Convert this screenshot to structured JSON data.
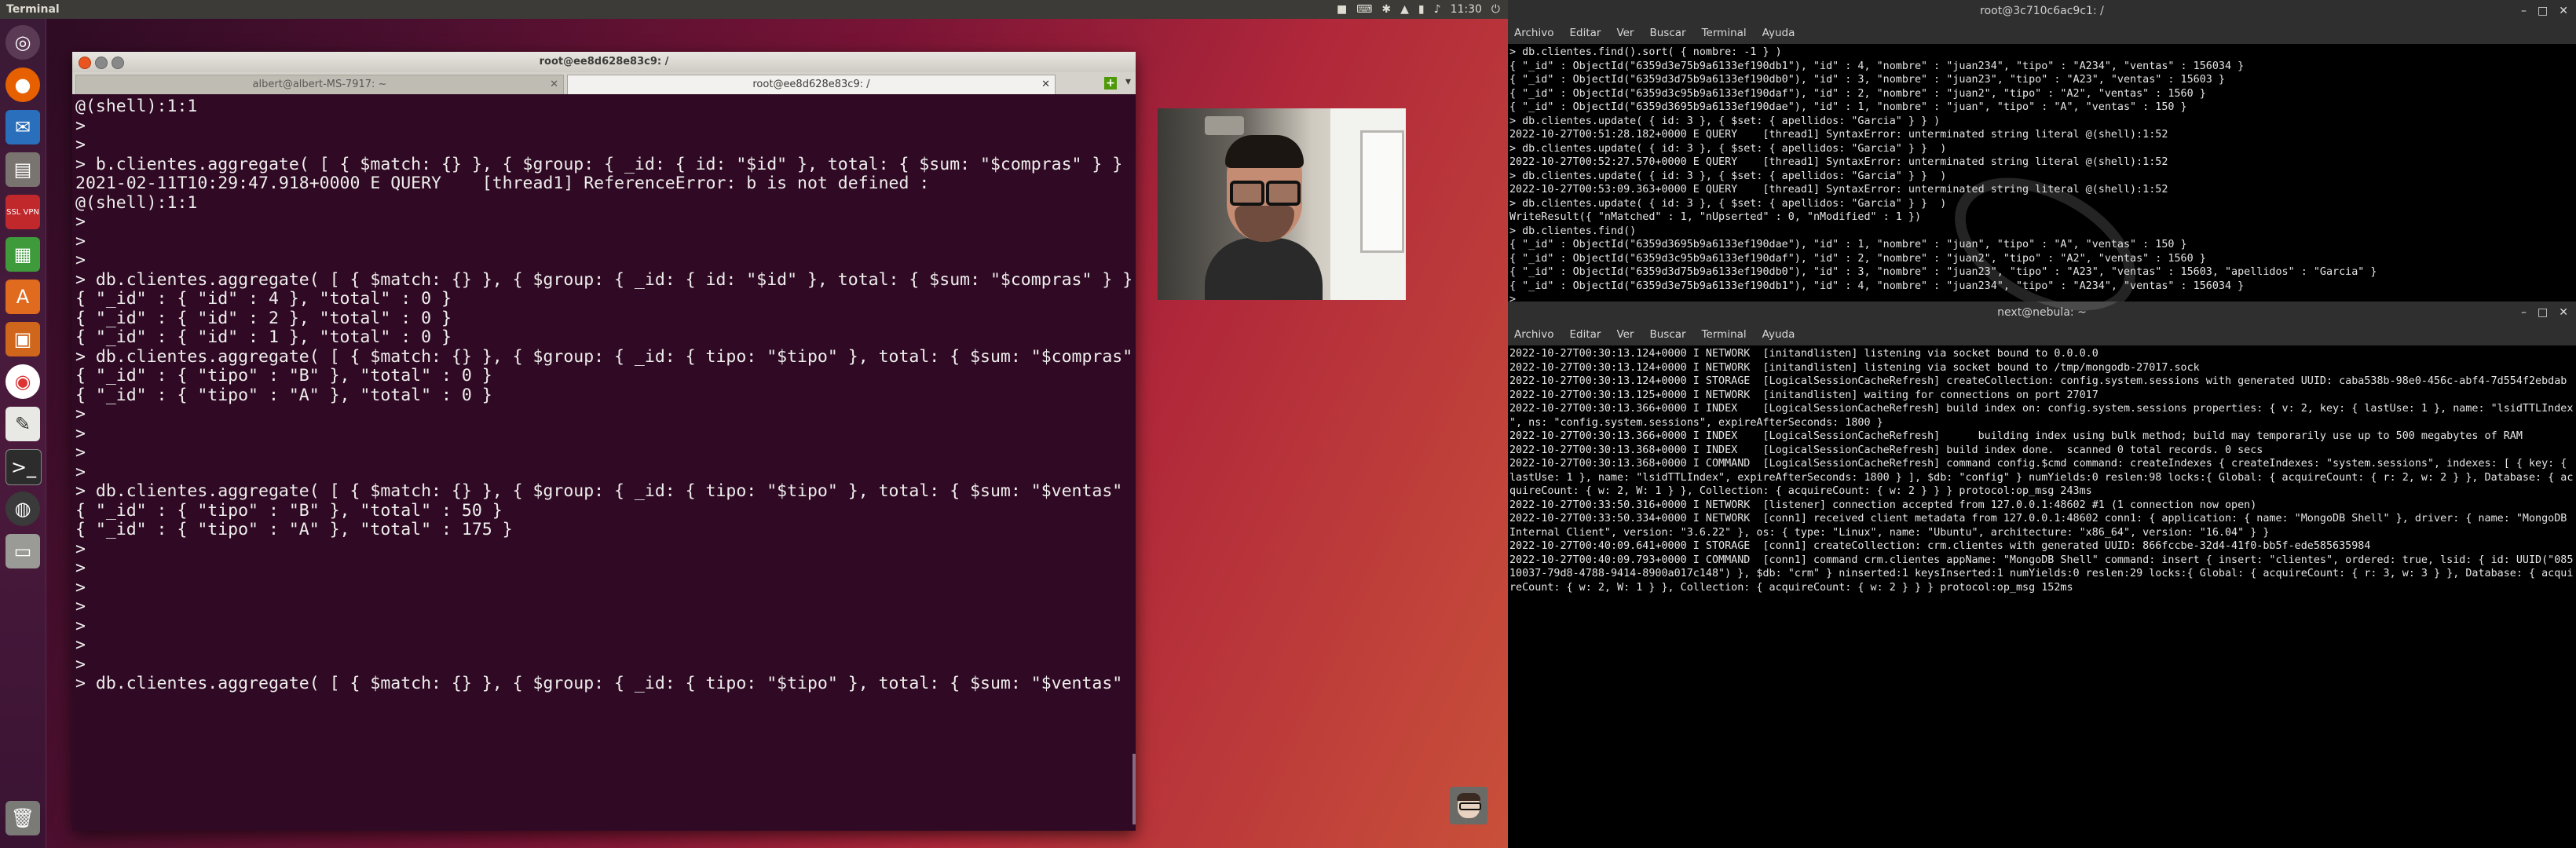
{
  "topbar": {
    "app_title": "Terminal",
    "clock": "11:30",
    "tray_icons": [
      "video-icon",
      "keyboard-icon",
      "bluetooth-icon",
      "wifi-icon",
      "battery-icon",
      "volume-icon",
      "power-icon"
    ]
  },
  "launcher": {
    "items": [
      "ubuntu-icon",
      "firefox-icon",
      "thunderbird-icon",
      "files-icon",
      "ssl-vpn-icon",
      "calc-icon",
      "software-icon",
      "presentation-icon",
      "chrome-icon",
      "editor-icon",
      "terminal-icon",
      "obs-icon",
      "storage-icon",
      "trash-icon"
    ],
    "ssl_label": "SSL VPN"
  },
  "left_terminal": {
    "title": "root@ee8d628e83c9: /",
    "tabs": [
      {
        "label": "albert@albert-MS-7917: ~"
      },
      {
        "label": "root@ee8d628e83c9: /"
      }
    ],
    "output": "@(shell):1:1\n>\n> \n> b.clientes.aggregate( [ { $match: {} }, { $group: { _id: { id: \"$id\" }, total: { $sum: \"$compras\" } } ] )\n2021-02-11T10:29:47.918+0000 E QUERY    [thread1] ReferenceError: b is not defined :\n@(shell):1:1\n>\n>\n>\n> db.clientes.aggregate( [ { $match: {} }, { $group: { _id: { id: \"$id\" }, total: { $sum: \"$compras\" } } } ] )\n{ \"_id\" : { \"id\" : 4 }, \"total\" : 0 }\n{ \"_id\" : { \"id\" : 2 }, \"total\" : 0 }\n{ \"_id\" : { \"id\" : 1 }, \"total\" : 0 }\n> db.clientes.aggregate( [ { $match: {} }, { $group: { _id: { tipo: \"$tipo\" }, total: { $sum: \"$compras\" } } } ] )\n{ \"_id\" : { \"tipo\" : \"B\" }, \"total\" : 0 }\n{ \"_id\" : { \"tipo\" : \"A\" }, \"total\" : 0 }\n>\n>\n>\n>\n> db.clientes.aggregate( [ { $match: {} }, { $group: { _id: { tipo: \"$tipo\" }, total: { $sum: \"$ventas\" } } } ] )\n{ \"_id\" : { \"tipo\" : \"B\" }, \"total\" : 50 }\n{ \"_id\" : { \"tipo\" : \"A\" }, \"total\" : 175 }\n>\n>\n>\n>\n>\n>\n>\n> db.clientes.aggregate( [ { $match: {} }, { $group: { _id: { tipo: \"$tipo\" }, total: { $sum: \"$ventas\" } } } ] )"
  },
  "right_top": {
    "title": "root@3c710c6ac9c1: /",
    "output": "> db.clientes.find().sort( { nombre: -1 } )\n{ \"_id\" : ObjectId(\"6359d3e75b9a6133ef190db1\"), \"id\" : 4, \"nombre\" : \"juan234\", \"tipo\" : \"A234\", \"ventas\" : 156034 }\n{ \"_id\" : ObjectId(\"6359d3d75b9a6133ef190db0\"), \"id\" : 3, \"nombre\" : \"juan23\", \"tipo\" : \"A23\", \"ventas\" : 15603 }\n{ \"_id\" : ObjectId(\"6359d3c95b9a6133ef190daf\"), \"id\" : 2, \"nombre\" : \"juan2\", \"tipo\" : \"A2\", \"ventas\" : 1560 }\n{ \"_id\" : ObjectId(\"6359d3695b9a6133ef190dae\"), \"id\" : 1, \"nombre\" : \"juan\", \"tipo\" : \"A\", \"ventas\" : 150 }\n> db.clientes.update( { id: 3 }, { $set: { apellidos: \"Garcia\" } } )\n2022-10-27T00:51:28.182+0000 E QUERY    [thread1] SyntaxError: unterminated string literal @(shell):1:52\n> db.clientes.update( { id: 3 }, { $set: { apellidos: \"Garcia\" } }  )\n2022-10-27T00:52:27.570+0000 E QUERY    [thread1] SyntaxError: unterminated string literal @(shell):1:52\n> db.clientes.update( { id: 3 }, { $set: { apellidos: \"Garcia\" } }  )\n2022-10-27T00:53:09.363+0000 E QUERY    [thread1] SyntaxError: unterminated string literal @(shell):1:52\n> db.clientes.update( { id: 3 }, { $set: { apellidos: \"Garcia\" } }  )\nWriteResult({ \"nMatched\" : 1, \"nUpserted\" : 0, \"nModified\" : 1 })\n> db.clientes.find()\n{ \"_id\" : ObjectId(\"6359d3695b9a6133ef190dae\"), \"id\" : 1, \"nombre\" : \"juan\", \"tipo\" : \"A\", \"ventas\" : 150 }\n{ \"_id\" : ObjectId(\"6359d3c95b9a6133ef190daf\"), \"id\" : 2, \"nombre\" : \"juan2\", \"tipo\" : \"A2\", \"ventas\" : 1560 }\n{ \"_id\" : ObjectId(\"6359d3d75b9a6133ef190db0\"), \"id\" : 3, \"nombre\" : \"juan23\", \"tipo\" : \"A23\", \"ventas\" : 15603, \"apellidos\" : \"Garcia\" }\n{ \"_id\" : ObjectId(\"6359d3e75b9a6133ef190db1\"), \"id\" : 4, \"nombre\" : \"juan234\", \"tipo\" : \"A234\", \"ventas\" : 156034 }\n>"
  },
  "right_bottom": {
    "title": "next@nebula: ~",
    "menu": [
      "Archivo",
      "Editar",
      "Ver",
      "Buscar",
      "Terminal",
      "Ayuda"
    ],
    "output": "2022-10-27T00:30:13.124+0000 I NETWORK  [initandlisten] listening via socket bound to 0.0.0.0\n2022-10-27T00:30:13.124+0000 I NETWORK  [initandlisten] listening via socket bound to /tmp/mongodb-27017.sock\n2022-10-27T00:30:13.124+0000 I STORAGE  [LogicalSessionCacheRefresh] createCollection: config.system.sessions with generated UUID: caba538b-98e0-456c-abf4-7d554f2ebdab\n2022-10-27T00:30:13.125+0000 I NETWORK  [initandlisten] waiting for connections on port 27017\n2022-10-27T00:30:13.366+0000 I INDEX    [LogicalSessionCacheRefresh] build index on: config.system.sessions properties: { v: 2, key: { lastUse: 1 }, name: \"lsidTTLIndex\n\", ns: \"config.system.sessions\", expireAfterSeconds: 1800 }\n2022-10-27T00:30:13.366+0000 I INDEX    [LogicalSessionCacheRefresh]      building index using bulk method; build may temporarily use up to 500 megabytes of RAM\n2022-10-27T00:30:13.368+0000 I INDEX    [LogicalSessionCacheRefresh] build index done.  scanned 0 total records. 0 secs\n2022-10-27T00:30:13.368+0000 I COMMAND  [LogicalSessionCacheRefresh] command config.$cmd command: createIndexes { createIndexes: \"system.sessions\", indexes: [ { key: {\nlastUse: 1 }, name: \"lsidTTLIndex\", expireAfterSeconds: 1800 } ], $db: \"config\" } numYields:0 reslen:98 locks:{ Global: { acquireCount: { r: 2, w: 2 } }, Database: { ac\nquireCount: { w: 2, W: 1 } }, Collection: { acquireCount: { w: 2 } } } protocol:op_msg 243ms\n2022-10-27T00:33:50.316+0000 I NETWORK  [listener] connection accepted from 127.0.0.1:48602 #1 (1 connection now open)\n2022-10-27T00:33:50.334+0000 I NETWORK  [conn1] received client metadata from 127.0.0.1:48602 conn1: { application: { name: \"MongoDB Shell\" }, driver: { name: \"MongoDB\nInternal Client\", version: \"3.6.22\" }, os: { type: \"Linux\", name: \"Ubuntu\", architecture: \"x86_64\", version: \"16.04\" } }\n2022-10-27T00:40:09.641+0000 I STORAGE  [conn1] createCollection: crm.clientes with generated UUID: 866fccbe-32d4-41f0-bb5f-ede585635984\n2022-10-27T00:40:09.793+0000 I COMMAND  [conn1] command crm.clientes appName: \"MongoDB Shell\" command: insert { insert: \"clientes\", ordered: true, lsid: { id: UUID(\"085\n10037-79d8-4788-9414-8900a017c148\") }, $db: \"crm\" } ninserted:1 keysInserted:1 numYields:0 reslen:29 locks:{ Global: { acquireCount: { r: 3, w: 3 } }, Database: { acqui\nreCount: { w: 2, W: 1 } }, Collection: { acquireCount: { w: 2 } } } protocol:op_msg 152ms"
  }
}
